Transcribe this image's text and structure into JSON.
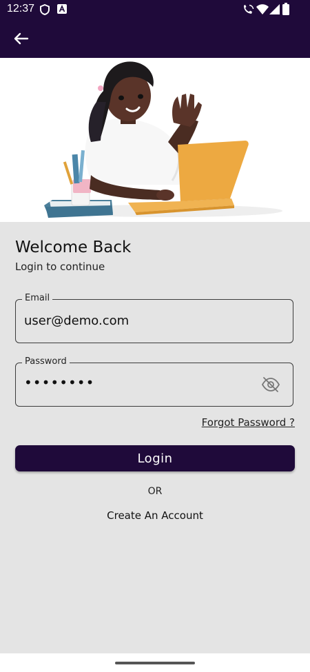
{
  "status_bar": {
    "time": "12:37",
    "left_icons": [
      "shield-icon",
      "a-app-icon"
    ],
    "right_icons": [
      "wifi-call-icon",
      "wifi-icon",
      "signal-icon",
      "battery-icon"
    ]
  },
  "app_bar": {
    "back_icon": "arrow-left-icon",
    "color": "#1f0a3a"
  },
  "hero": {
    "image": "woman-waving-at-laptop-illustration"
  },
  "login": {
    "title": "Welcome Back",
    "subtitle": "Login to continue",
    "email_label": "Email",
    "email_value": "user@demo.com",
    "password_label": "Password",
    "password_value": "••••••••",
    "password_toggle_icon": "eye-off-icon",
    "forgot_label": "Forgot Password ?",
    "login_button": "Login",
    "or_text": "OR",
    "create_account": "Create An Account"
  },
  "colors": {
    "primary": "#1f0a3a",
    "background": "#e4e4e4"
  }
}
